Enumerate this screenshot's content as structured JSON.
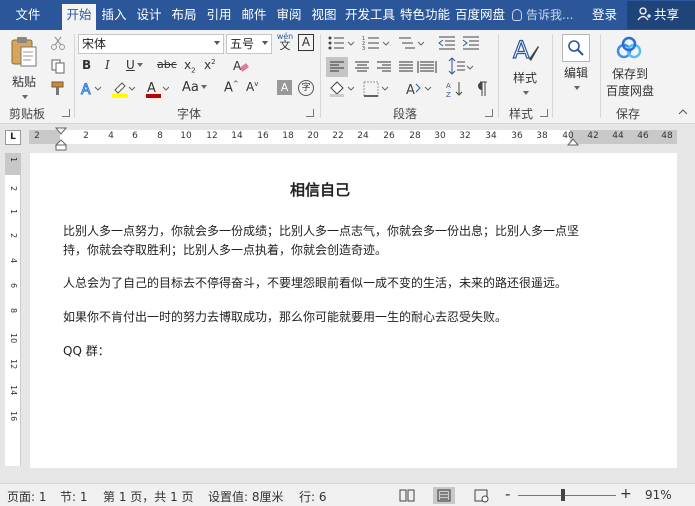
{
  "tabs": [
    {
      "label": "文件"
    },
    {
      "label": "开始",
      "active": true
    },
    {
      "label": "插入"
    },
    {
      "label": "设计"
    },
    {
      "label": "布局"
    },
    {
      "label": "引用"
    },
    {
      "label": "邮件"
    },
    {
      "label": "审阅"
    },
    {
      "label": "视图"
    },
    {
      "label": "开发工具"
    },
    {
      "label": "特色功能"
    },
    {
      "label": "百度网盘"
    }
  ],
  "tell_me": "告诉我...",
  "login": "登录",
  "share": "共享",
  "clipboard": {
    "paste": "粘贴",
    "label": "剪贴板"
  },
  "font": {
    "name": "宋体",
    "size": "五号",
    "label": "字体",
    "pinyin_top": "wén",
    "pinyin_bottom": "文",
    "border_char": "A"
  },
  "paragraph": {
    "label": "段落"
  },
  "styles": {
    "button": "样式",
    "label": "样式"
  },
  "editing": {
    "button": "编辑"
  },
  "save": {
    "button_line1": "保存到",
    "button_line2": "百度网盘",
    "label": "保存"
  },
  "ruler": {
    "tab_selector": "L",
    "marks": [
      "2",
      "2",
      "4",
      "6",
      "8",
      "10",
      "12",
      "14",
      "16",
      "18",
      "20",
      "22",
      "24",
      "26",
      "28",
      "30",
      "32",
      "34",
      "36",
      "38",
      "40",
      "42",
      "44",
      "46",
      "48"
    ]
  },
  "vruler_marks": [
    "1",
    "2",
    "1",
    "2",
    "4",
    "6",
    "8",
    "10",
    "12",
    "14",
    "16"
  ],
  "document": {
    "title": "相信自己",
    "paragraphs": [
      "比别人多一点努力，你就会多一份成绩；比别人多一点志气，你就会多一份出息；比别人多一点坚持，你就会夺取胜利；比别人多一点执着，你就会创造奇迹。",
      "人总会为了自己的目标去不停得奋斗，不要埋怨眼前看似一成不变的生活，未来的路还很遥远。",
      "如果你不肯付出一时的努力去博取成功，那么你可能就要用一生的耐心去忍受失败。",
      "QQ 群："
    ]
  },
  "status": {
    "page": "页面: 1",
    "section": "节: 1",
    "pages": "第 1 页，共 1 页",
    "setting": "设置值: 8厘米",
    "row": "行: 6",
    "zoom": "91%",
    "zoom_minus": "-",
    "zoom_plus": "+"
  },
  "colors": {
    "brand": "#2b579a",
    "highlight": "#ffff00",
    "font_color": "#c00000"
  }
}
